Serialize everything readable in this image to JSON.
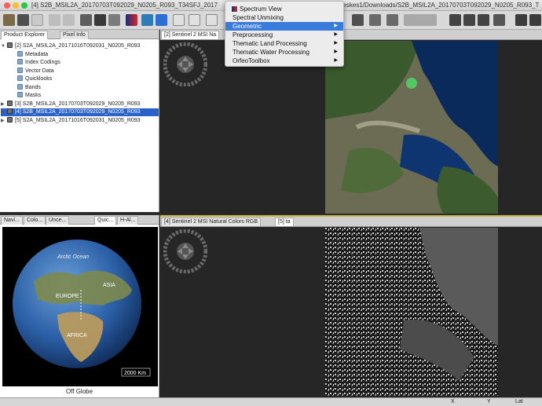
{
  "window": {
    "title_left": "[4] S2B_MSIL2A_20170703T092029_N0205_R093_T34SFJ_2017",
    "title_right": "aeskes1/Downloads/S2B_MSIL2A_20170703T092029_N0205_R093_T"
  },
  "left_panel": {
    "tabs": [
      "Product Explorer",
      "Pixel Info"
    ],
    "tree": [
      {
        "label": "[2] S2A_MSIL2A_20171016T092031_N0205_R093",
        "kind": "product",
        "expanded": true
      },
      {
        "label": "Metadata",
        "kind": "folder"
      },
      {
        "label": "Index Codings",
        "kind": "folder"
      },
      {
        "label": "Vector Data",
        "kind": "folder"
      },
      {
        "label": "Quicklooks",
        "kind": "folder"
      },
      {
        "label": "Bands",
        "kind": "folder"
      },
      {
        "label": "Masks",
        "kind": "folder"
      },
      {
        "label": "[3] S2B_MSIL2A_20170703T092029_N0205_R093",
        "kind": "product"
      },
      {
        "label": "[4] S2B_MSIL2A_20170703T092029_N0205_R093",
        "kind": "product",
        "selected": true
      },
      {
        "label": "[5] S2A_MSIL2A_20171016T092031_N0205_R093",
        "kind": "product"
      }
    ]
  },
  "nav_panel": {
    "tabs": [
      "Navi...",
      "Colo...",
      "Unce...",
      "Quic...",
      "H-Al..."
    ],
    "globe_labels": {
      "arctic": "Arctic Ocean",
      "europe": "EUROPE",
      "asia": "ASIA",
      "africa": "AFRICA"
    },
    "scale": "2000 Km",
    "caption": "Off Globe"
  },
  "top_view": {
    "tab": "[2] Sentinel 2 MSI Na"
  },
  "bottom_view": {
    "tabs": [
      "[4] Sentinel 2 MSI Natural Colors RGB",
      "[5] ta"
    ]
  },
  "menu": {
    "items": [
      {
        "label": "Spectrum View",
        "icon": "spectrum-icon",
        "submenu": false
      },
      {
        "label": "Spectral Unmixing",
        "submenu": false
      },
      {
        "label": "Geometric",
        "submenu": true,
        "highlighted": true
      },
      {
        "label": "Preprocessing",
        "submenu": true
      },
      {
        "label": "Thematic Land Processing",
        "submenu": true
      },
      {
        "label": "Thematic Water Processing",
        "submenu": true
      },
      {
        "label": "OrfeoToolbox",
        "submenu": true
      }
    ]
  },
  "status": {
    "x_label": "X",
    "y_label": "Y",
    "lat_label": "Lat"
  },
  "colors": {
    "selection": "#2a62c9",
    "menu_highlight": "#3a7bdc"
  }
}
